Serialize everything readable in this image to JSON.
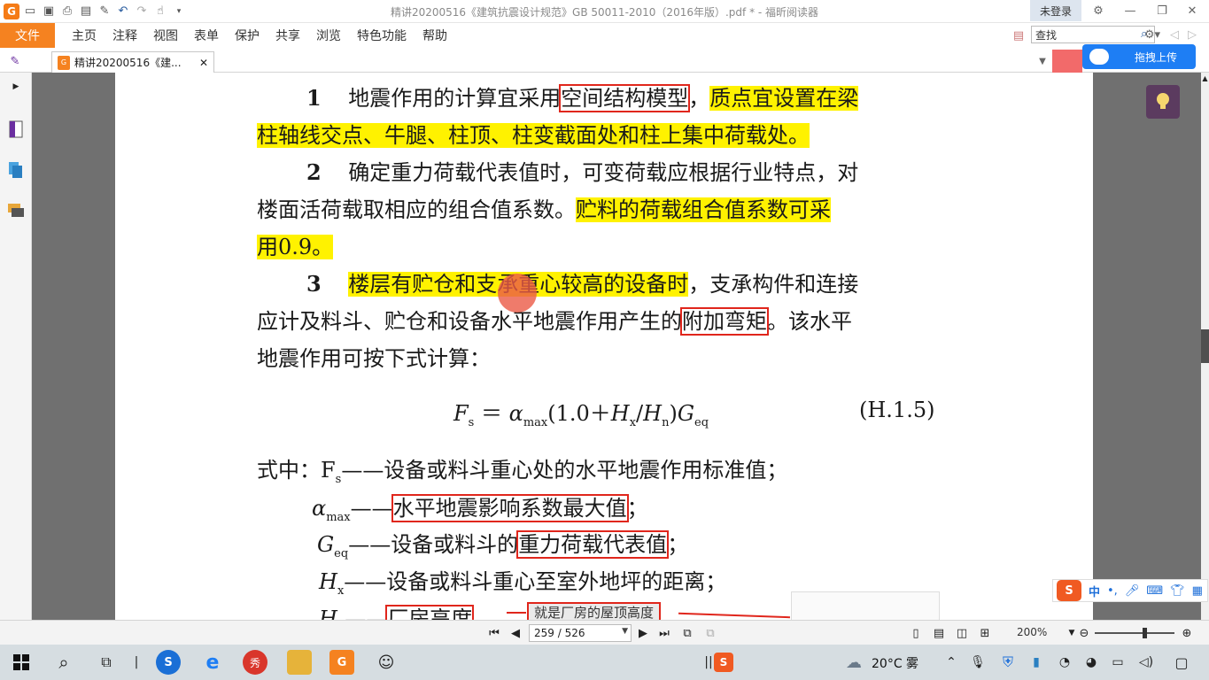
{
  "window": {
    "title": "精讲20200516《建筑抗震设计规范》GB 50011-2010（2016年版）.pdf * - 福昕阅读器",
    "login_label": "未登录"
  },
  "menu": {
    "file": "文件",
    "items": [
      "主页",
      "注释",
      "视图",
      "表单",
      "保护",
      "共享",
      "浏览",
      "特色功能",
      "帮助"
    ]
  },
  "search": {
    "value": "查找"
  },
  "doc_tab": {
    "label": "精讲20200516《建..."
  },
  "upload": {
    "label": "拖拽上传"
  },
  "content": {
    "p1": {
      "num": "1",
      "a": "地震作用的计算宜采用",
      "box": "空间结构模型",
      "b": "，",
      "hl1": "质点宜设置在梁",
      "hl2": "柱轴线交点、牛腿、柱顶、柱变截面处和柱上集中荷载处。"
    },
    "p2": {
      "num": "2",
      "line1": "确定重力荷载代表值时，可变荷载应根据行业特点，对",
      "a": "楼面活荷载取相应的组合值系数。",
      "hl1": "贮料的荷载组合值系数可采",
      "hl2": "用0.9。"
    },
    "p3": {
      "num": "3",
      "hl": "楼层有贮仓和支承重心较高的设备时",
      "a": "，支承构件和连接",
      "b": "应计及料斗、贮仓和设备水平地震作用产生的",
      "box": "附加弯矩",
      "c": "。该水平",
      "line3": "地震作用可按下式计算："
    },
    "formula": {
      "lhs_sym": "F",
      "lhs_sub": "s",
      "eq": " ＝ ",
      "alpha": "α",
      "alpha_sub": "max",
      "mid": "(1.0＋",
      "hx": "H",
      "hx_sub": "x",
      "slash": "/",
      "hn": "H",
      "hn_sub": "n",
      "close": ")",
      "g": "G",
      "g_sub": "eq",
      "ref": "(H.1.5)"
    },
    "defs": {
      "intro": "式中：",
      "fs_sym": "F",
      "fs_sub": "s",
      "fs_text": "——设备或料斗重心处的水平地震作用标准值；",
      "a_sym": "α",
      "a_sub": "max",
      "a_dash": "——",
      "a_box": "水平地震影响系数最大值",
      "a_end": "；",
      "g_sym": "G",
      "g_sub": "eq",
      "g_dash": "——设备或料斗的",
      "g_box": "重力荷载代表值",
      "g_end": "；",
      "hx_sym": "H",
      "hx_sub": "x",
      "hx_text": "——设备或料斗重心至室外地坪的距离；",
      "hn_sym": "H",
      "hn_sub": "n",
      "hn_dash": "——",
      "hn_box": "厂房高度"
    },
    "annotation": "就是厂房的屋顶高度"
  },
  "status": {
    "page": "259 / 526",
    "zoom": "200%"
  },
  "taskbar": {
    "weather": "20°C 雾"
  },
  "ime": {
    "logo": "S",
    "lang": "中"
  },
  "colors": {
    "accent": "#f58220",
    "highlight": "#fff200",
    "box": "#e0261c"
  }
}
